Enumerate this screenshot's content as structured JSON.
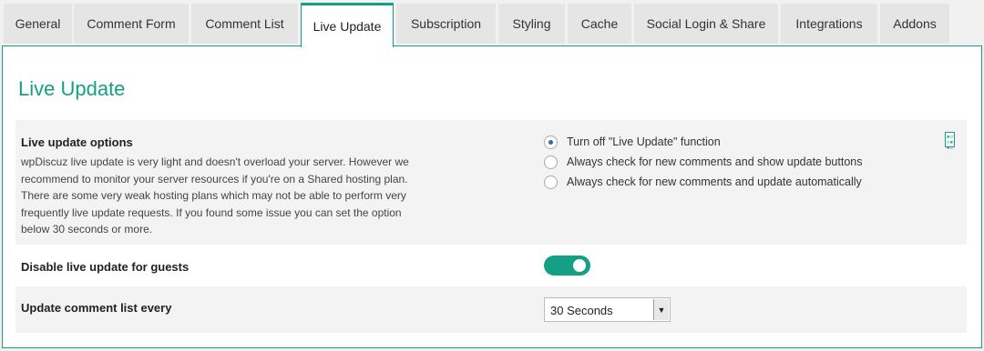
{
  "tabs": [
    {
      "label": "General"
    },
    {
      "label": "Comment Form"
    },
    {
      "label": "Comment List"
    },
    {
      "label": "Live Update",
      "active": true
    },
    {
      "label": "Subscription"
    },
    {
      "label": "Styling"
    },
    {
      "label": "Cache"
    },
    {
      "label": "Social Login & Share"
    },
    {
      "label": "Integrations"
    },
    {
      "label": "Addons"
    }
  ],
  "page": {
    "title": "Live Update"
  },
  "live_update_options": {
    "label": "Live update options",
    "description": "wpDiscuz live update is very light and doesn't overload your server. However we recommend to monitor your server resources if you're on a Shared hosting plan. There are some very weak hosting plans which may not be able to perform very frequently live update requests. If you found some issue you can set the option below 30 seconds or more.",
    "options": [
      {
        "label": "Turn off \"Live Update\" function",
        "checked": true
      },
      {
        "label": "Always check for new comments and show update buttons",
        "checked": false
      },
      {
        "label": "Always check for new comments and update automatically",
        "checked": false
      }
    ],
    "doc_icon": "document-icon"
  },
  "disable_guests": {
    "label": "Disable live update for guests",
    "enabled": true
  },
  "update_interval": {
    "label": "Update comment list every",
    "selected": "30 Seconds"
  },
  "colors": {
    "accent": "#14a085",
    "radio_checked": "#2271b1"
  }
}
